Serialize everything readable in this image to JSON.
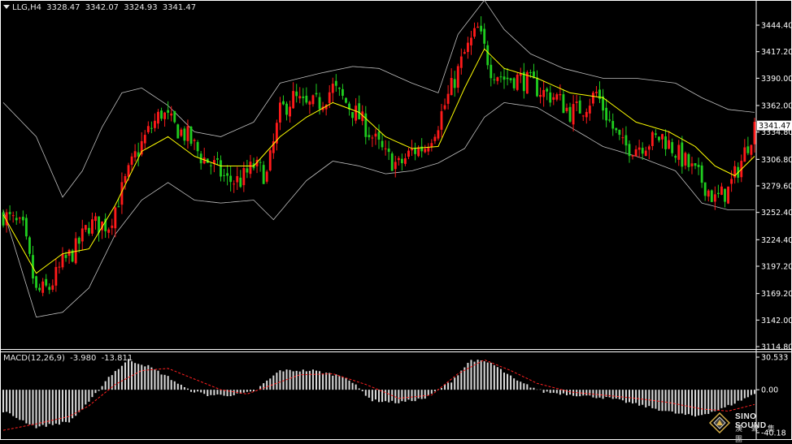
{
  "header": {
    "symbol": "LLG,H4",
    "open": "3328.47",
    "high": "3342.07",
    "low": "3324.93",
    "close": "3341.47"
  },
  "macd": {
    "label": "MACD(12,26,9)",
    "main": "-3.980",
    "signal": "-13.811"
  },
  "logo": {
    "brand": "SINO SOUND",
    "subtitle": "漢 聲 集 團"
  },
  "colors": {
    "background": "#000000",
    "bull": "#ff1a1a",
    "bear": "#1fcc1f",
    "band": "#bfbfbf",
    "ma": "#ffff00",
    "macd_hist": "#d9d9d9",
    "macd_signal": "#ff2020",
    "grid_text": "#ffffff",
    "price_box": "#ffffff"
  },
  "chart_data": [
    {
      "type": "candlestick",
      "title": "LLG,H4",
      "indicators": [
        "Bollinger Bands",
        "Moving Average"
      ],
      "ylim": [
        3114.8,
        3465.0
      ],
      "y_ticks": [
        3444.4,
        3417.2,
        3390.0,
        3362.0,
        3334.8,
        3306.8,
        3279.6,
        3252.4,
        3224.4,
        3197.2,
        3169.2,
        3142.0,
        3114.8
      ],
      "y_tick_labels": [
        "3444.40",
        "3417.20",
        "3390.00",
        "3362.00",
        "3334.80",
        "3306.80",
        "3279.60",
        "3252.40",
        "3224.40",
        "3197.20",
        "3169.20",
        "3142.00",
        "3114.80"
      ],
      "current_price": "3341.47",
      "close_path": [
        [
          0,
          3250
        ],
        [
          6,
          3235
        ],
        [
          10,
          3170
        ],
        [
          14,
          3175
        ],
        [
          18,
          3200
        ],
        [
          22,
          3215
        ],
        [
          26,
          3240
        ],
        [
          32,
          3240
        ],
        [
          36,
          3275
        ],
        [
          40,
          3310
        ],
        [
          44,
          3335
        ],
        [
          48,
          3355
        ],
        [
          52,
          3340
        ],
        [
          56,
          3330
        ],
        [
          60,
          3310
        ],
        [
          64,
          3300
        ],
        [
          68,
          3285
        ],
        [
          72,
          3285
        ],
        [
          76,
          3300
        ],
        [
          80,
          3290
        ],
        [
          84,
          3355
        ],
        [
          88,
          3370
        ],
        [
          92,
          3360
        ],
        [
          96,
          3365
        ],
        [
          100,
          3380
        ],
        [
          104,
          3365
        ],
        [
          108,
          3350
        ],
        [
          112,
          3330
        ],
        [
          116,
          3310
        ],
        [
          120,
          3300
        ],
        [
          124,
          3315
        ],
        [
          128,
          3320
        ],
        [
          132,
          3345
        ],
        [
          136,
          3380
        ],
        [
          140,
          3415
        ],
        [
          144,
          3440
        ],
        [
          148,
          3400
        ],
        [
          152,
          3390
        ],
        [
          156,
          3390
        ],
        [
          160,
          3385
        ],
        [
          164,
          3375
        ],
        [
          168,
          3370
        ],
        [
          172,
          3355
        ],
        [
          176,
          3360
        ],
        [
          180,
          3375
        ],
        [
          184,
          3345
        ],
        [
          188,
          3320
        ],
        [
          192,
          3320
        ],
        [
          196,
          3325
        ],
        [
          200,
          3330
        ],
        [
          204,
          3315
        ],
        [
          208,
          3300
        ],
        [
          212,
          3285
        ],
        [
          216,
          3265
        ],
        [
          220,
          3275
        ],
        [
          224,
          3305
        ],
        [
          228,
          3341.47
        ]
      ],
      "bollinger": {
        "upper": [
          [
            0,
            3365
          ],
          [
            10,
            3330
          ],
          [
            18,
            3268
          ],
          [
            24,
            3295
          ],
          [
            30,
            3340
          ],
          [
            36,
            3375
          ],
          [
            42,
            3380
          ],
          [
            50,
            3362
          ],
          [
            58,
            3335
          ],
          [
            66,
            3330
          ],
          [
            76,
            3345
          ],
          [
            84,
            3385
          ],
          [
            96,
            3395
          ],
          [
            106,
            3402
          ],
          [
            114,
            3400
          ],
          [
            124,
            3385
          ],
          [
            132,
            3375
          ],
          [
            138,
            3435
          ],
          [
            146,
            3470
          ],
          [
            152,
            3440
          ],
          [
            160,
            3415
          ],
          [
            170,
            3400
          ],
          [
            182,
            3390
          ],
          [
            192,
            3390
          ],
          [
            204,
            3385
          ],
          [
            212,
            3370
          ],
          [
            220,
            3358
          ],
          [
            228,
            3355
          ]
        ],
        "lower": [
          [
            0,
            3255
          ],
          [
            10,
            3145
          ],
          [
            18,
            3150
          ],
          [
            26,
            3175
          ],
          [
            34,
            3230
          ],
          [
            42,
            3265
          ],
          [
            50,
            3283
          ],
          [
            58,
            3265
          ],
          [
            66,
            3262
          ],
          [
            76,
            3265
          ],
          [
            82,
            3245
          ],
          [
            92,
            3285
          ],
          [
            100,
            3305
          ],
          [
            108,
            3300
          ],
          [
            116,
            3292
          ],
          [
            124,
            3295
          ],
          [
            132,
            3303
          ],
          [
            140,
            3318
          ],
          [
            146,
            3350
          ],
          [
            152,
            3365
          ],
          [
            162,
            3360
          ],
          [
            172,
            3340
          ],
          [
            182,
            3320
          ],
          [
            194,
            3308
          ],
          [
            204,
            3295
          ],
          [
            212,
            3262
          ],
          [
            220,
            3255
          ],
          [
            228,
            3255
          ]
        ],
        "ma": [
          [
            0,
            3250
          ],
          [
            10,
            3190
          ],
          [
            18,
            3210
          ],
          [
            26,
            3215
          ],
          [
            34,
            3260
          ],
          [
            42,
            3315
          ],
          [
            50,
            3330
          ],
          [
            58,
            3310
          ],
          [
            66,
            3300
          ],
          [
            76,
            3300
          ],
          [
            84,
            3330
          ],
          [
            92,
            3350
          ],
          [
            100,
            3365
          ],
          [
            108,
            3355
          ],
          [
            116,
            3330
          ],
          [
            124,
            3318
          ],
          [
            132,
            3320
          ],
          [
            140,
            3380
          ],
          [
            146,
            3420
          ],
          [
            152,
            3400
          ],
          [
            162,
            3390
          ],
          [
            172,
            3375
          ],
          [
            182,
            3370
          ],
          [
            192,
            3345
          ],
          [
            202,
            3335
          ],
          [
            210,
            3320
          ],
          [
            216,
            3300
          ],
          [
            222,
            3290
          ],
          [
            228,
            3310
          ]
        ]
      }
    },
    {
      "type": "bar",
      "title": "MACD(12,26,9)",
      "ylim": [
        -40.18,
        30.533
      ],
      "y_ticks": [
        30.533,
        0.0,
        -40.18
      ],
      "y_tick_labels": [
        "30.533",
        "0.00",
        "-40.18"
      ],
      "macd_path": [
        [
          0,
          -20
        ],
        [
          10,
          -35
        ],
        [
          20,
          -30
        ],
        [
          26,
          -12
        ],
        [
          32,
          12
        ],
        [
          38,
          28
        ],
        [
          44,
          22
        ],
        [
          50,
          12
        ],
        [
          56,
          0
        ],
        [
          62,
          -5
        ],
        [
          70,
          -5
        ],
        [
          76,
          -2
        ],
        [
          84,
          18
        ],
        [
          94,
          18
        ],
        [
          104,
          12
        ],
        [
          112,
          -10
        ],
        [
          120,
          -12
        ],
        [
          128,
          -8
        ],
        [
          136,
          8
        ],
        [
          142,
          28
        ],
        [
          148,
          25
        ],
        [
          156,
          8
        ],
        [
          164,
          -2
        ],
        [
          174,
          -5
        ],
        [
          184,
          -8
        ],
        [
          194,
          -15
        ],
        [
          204,
          -22
        ],
        [
          210,
          -25
        ],
        [
          218,
          -18
        ],
        [
          228,
          -3.98
        ]
      ],
      "signal_path": [
        [
          0,
          -38
        ],
        [
          10,
          -32
        ],
        [
          20,
          -25
        ],
        [
          26,
          -15
        ],
        [
          34,
          5
        ],
        [
          42,
          18
        ],
        [
          50,
          20
        ],
        [
          58,
          10
        ],
        [
          66,
          0
        ],
        [
          74,
          -4
        ],
        [
          82,
          5
        ],
        [
          90,
          14
        ],
        [
          100,
          15
        ],
        [
          110,
          5
        ],
        [
          120,
          -8
        ],
        [
          130,
          -5
        ],
        [
          138,
          15
        ],
        [
          146,
          28
        ],
        [
          154,
          18
        ],
        [
          162,
          6
        ],
        [
          172,
          -2
        ],
        [
          182,
          -5
        ],
        [
          192,
          -8
        ],
        [
          202,
          -12
        ],
        [
          212,
          -18
        ],
        [
          220,
          -20
        ],
        [
          228,
          -13.81
        ]
      ]
    }
  ]
}
